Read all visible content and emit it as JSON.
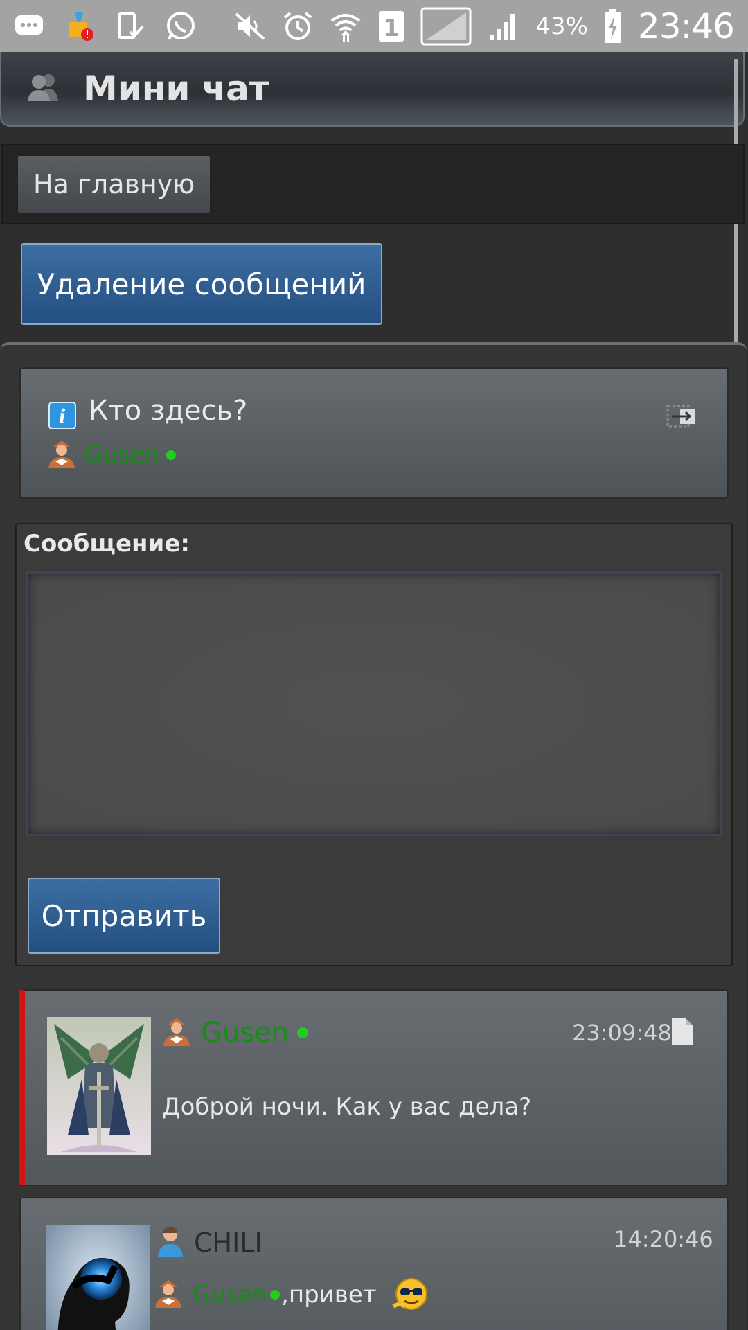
{
  "status_bar": {
    "battery_percent": "43%",
    "time": "23:46",
    "sim_slot": "1",
    "icons": [
      "message-icon",
      "cleaner-icon",
      "device-icon",
      "whatsapp-icon",
      "mute-icon",
      "alarm-icon",
      "wifi-icon",
      "sim-icon",
      "signal-icon",
      "battery-icon"
    ]
  },
  "header": {
    "title": "Мини чат",
    "icon": "users-icon"
  },
  "nav": {
    "home_label": "На главную"
  },
  "actions": {
    "delete_label": "Удаление сообщений"
  },
  "who": {
    "title": "Кто здесь?",
    "users": [
      {
        "name": "Gusen",
        "online": true
      }
    ]
  },
  "message_form": {
    "label": "Сообщение:",
    "value": "",
    "send_label": "Отправить"
  },
  "messages": [
    {
      "author": "Gusen",
      "online": true,
      "time": "23:09:48",
      "text": "Доброй ночи. Как у вас дела?"
    },
    {
      "author": "CHILI",
      "online": false,
      "time": "14:20:46",
      "mention": "Gusen",
      "text": ",привет"
    }
  ],
  "colors": {
    "status_bar": "#a3a3a3",
    "accent_blue": "#2f5e92",
    "online_green": "#1fcf1f",
    "name_green": "#148f14",
    "highlight_red": "#d11313"
  }
}
